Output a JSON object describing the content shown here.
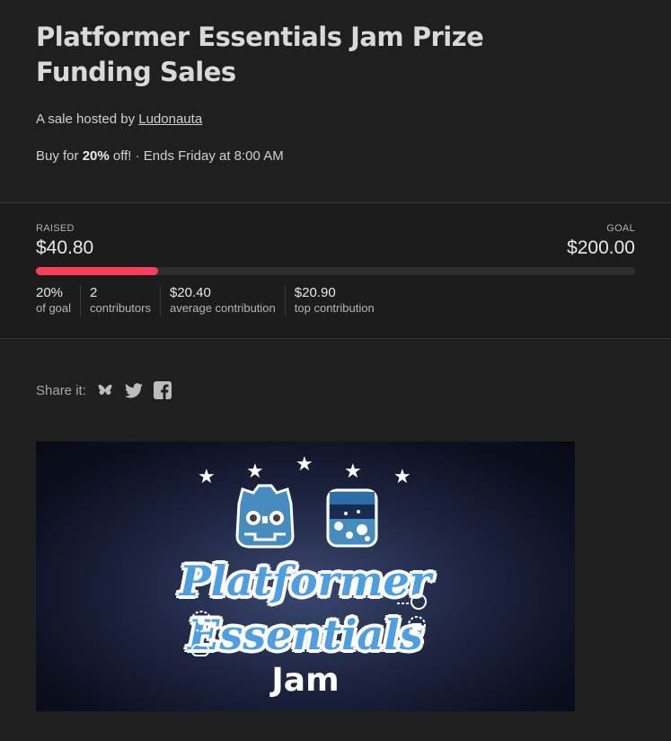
{
  "header": {
    "title": "Platformer Essentials Jam Prize Funding Sales",
    "host_prefix": "A sale hosted by ",
    "host_name": "Ludonauta",
    "offer_prefix": "Buy for ",
    "offer_discount": "20%",
    "offer_suffix": " off! · Ends Friday at 8:00 AM"
  },
  "stats": {
    "raised_label": "RAISED",
    "raised_value": "$40.80",
    "goal_label": "GOAL",
    "goal_value": "$200.00",
    "progress_fraction": 0.204,
    "bar_color": "#fa3f5a",
    "metrics": [
      {
        "value": "20%",
        "label": "of goal"
      },
      {
        "value": "2",
        "label": "contributors"
      },
      {
        "value": "$20.40",
        "label": "average contribution"
      },
      {
        "value": "$20.90",
        "label": "top contribution"
      }
    ]
  },
  "share": {
    "label": "Share it:",
    "icons": [
      "bluesky-icon",
      "twitter-icon",
      "facebook-icon"
    ]
  },
  "banner": {
    "line1": "Platformer",
    "line2": "Essentials",
    "line3": "Jam"
  }
}
